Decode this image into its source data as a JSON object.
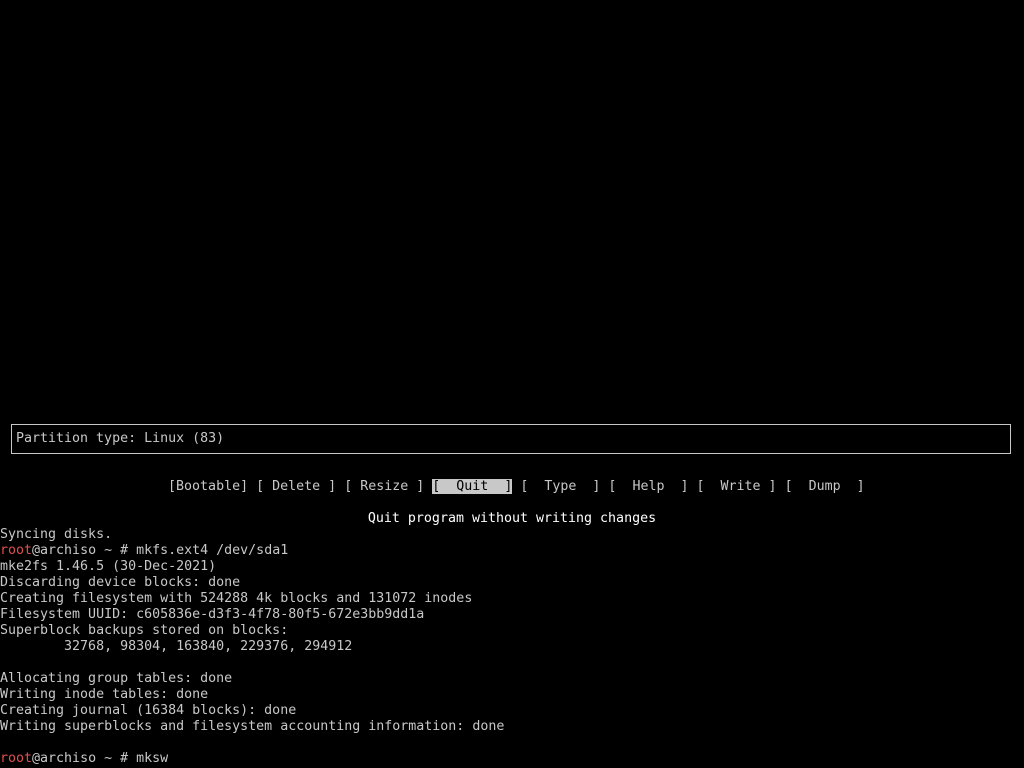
{
  "cfdisk": {
    "partition_info": "Partition type: Linux (83)",
    "menu": [
      {
        "label": "[Bootable]",
        "selected": false
      },
      {
        "label": "[ Delete ]",
        "selected": false
      },
      {
        "label": "[ Resize ]",
        "selected": false
      },
      {
        "label": "[  Quit  ]",
        "selected": true
      },
      {
        "label": "[  Type  ]",
        "selected": false
      },
      {
        "label": "[  Help  ]",
        "selected": false
      },
      {
        "label": "[  Write ]",
        "selected": false
      },
      {
        "label": "[  Dump  ]",
        "selected": false
      }
    ],
    "hint": "Quit program without writing changes"
  },
  "terminal": {
    "lines": [
      {
        "text": "Syncing disks."
      },
      {
        "user": "root",
        "rest": "@archiso ~ # mkfs.ext4 /dev/sda1"
      },
      {
        "text": "mke2fs 1.46.5 (30-Dec-2021)"
      },
      {
        "text": "Discarding device blocks: done"
      },
      {
        "text": "Creating filesystem with 524288 4k blocks and 131072 inodes"
      },
      {
        "text": "Filesystem UUID: c605836e-d3f3-4f78-80f5-672e3bb9dd1a"
      },
      {
        "text": "Superblock backups stored on blocks:"
      },
      {
        "text": "        32768, 98304, 163840, 229376, 294912"
      },
      {
        "text": ""
      },
      {
        "text": "Allocating group tables: done"
      },
      {
        "text": "Writing inode tables: done"
      },
      {
        "text": "Creating journal (16384 blocks): done"
      },
      {
        "text": "Writing superblocks and filesystem accounting information: done"
      },
      {
        "text": ""
      },
      {
        "user": "root",
        "rest": "@archiso ~ # mksw"
      }
    ]
  },
  "colors": {
    "background": "#000000",
    "foreground": "#c8c8c8",
    "user_prompt": "#e05050",
    "hint": "#ffffff"
  }
}
